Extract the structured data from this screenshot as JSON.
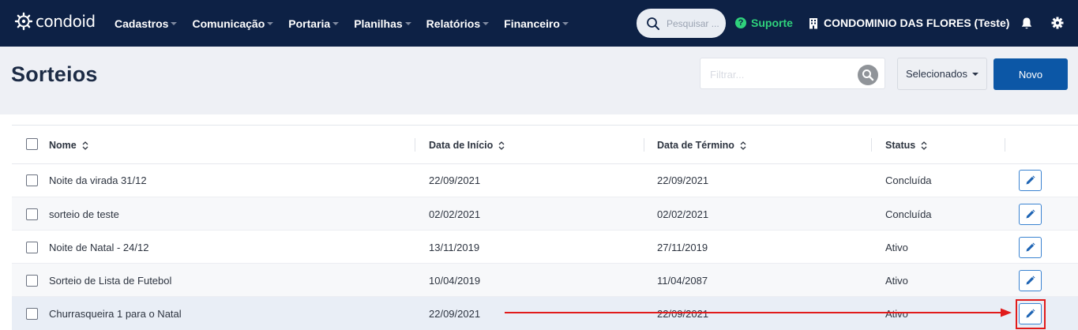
{
  "navbar": {
    "logo_text": "condoid",
    "menu": [
      {
        "label": "Cadastros"
      },
      {
        "label": "Comunicação"
      },
      {
        "label": "Portaria"
      },
      {
        "label": "Planilhas"
      },
      {
        "label": "Relatórios"
      },
      {
        "label": "Financeiro"
      }
    ],
    "search_placeholder": "Pesquisar ...",
    "support_label": "Suporte",
    "condo_label": "CONDOMINIO DAS FLORES (Teste)"
  },
  "page": {
    "title": "Sorteios",
    "filter_placeholder": "Filtrar...",
    "selecionados_label": "Selecionados",
    "novo_label": "Novo"
  },
  "table": {
    "columns": [
      "Nome",
      "Data de Início",
      "Data de Término",
      "Status"
    ],
    "rows": [
      {
        "nome": "Noite da virada 31/12",
        "inicio": "22/09/2021",
        "termino": "22/09/2021",
        "status": "Concluída"
      },
      {
        "nome": "sorteio de teste",
        "inicio": "02/02/2021",
        "termino": "02/02/2021",
        "status": "Concluída"
      },
      {
        "nome": "Noite de Natal - 24/12",
        "inicio": "13/11/2019",
        "termino": "27/11/2019",
        "status": "Ativo"
      },
      {
        "nome": "Sorteio de Lista de Futebol",
        "inicio": "10/04/2019",
        "termino": "11/04/2087",
        "status": "Ativo"
      },
      {
        "nome": "Churrasqueira 1 para o Natal",
        "inicio": "22/09/2021",
        "termino": "22/09/2021",
        "status": "Ativo"
      }
    ]
  },
  "colors": {
    "navbar_bg": "#0d2145",
    "accent_blue": "#0c57a6",
    "support_green": "#2fd27c",
    "annotation_red": "#e11b1b"
  }
}
